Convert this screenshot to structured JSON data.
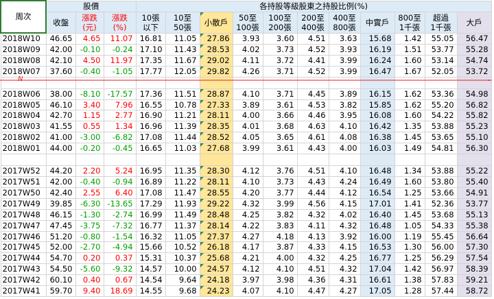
{
  "headers": {
    "week": "周次",
    "price_group": "股價",
    "holding_group": "各持股等級股東之持股比例(%)",
    "close": "收盤",
    "change": "漲跌\n(元)",
    "change_pct": "漲跌\n(%)",
    "b1": "10張\n以下",
    "b2": "10至\n50張",
    "small": "小散戶",
    "b3": "50至\n100張",
    "b4": "100至\n200張",
    "b5": "200至\n400張",
    "b6": "400至\n800張",
    "mid": "中實戶",
    "b7": "800至\n1千張",
    "b8": "超過\n1千張",
    "big": "大戶"
  },
  "marker_label": "N",
  "colors": {
    "up": "#ff0000",
    "down": "#00a000",
    "small_col": "#ffe699",
    "mid_col": "#ddebf7",
    "big_col": "#e4dfec",
    "header": "#ddebf7",
    "marker": "#e02020"
  },
  "groups": [
    {
      "rows": [
        [
          "2018W10",
          "46.65",
          "4.65",
          "11.07",
          "16.81",
          "11.05",
          "27.86",
          "3.93",
          "3.60",
          "4.51",
          "3.63",
          "15.68",
          "1.42",
          "55.05",
          "56.47"
        ],
        [
          "2018W09",
          "42.00",
          "-0.10",
          "-0.24",
          "17.10",
          "11.43",
          "28.53",
          "4.02",
          "3.73",
          "4.52",
          "3.93",
          "16.19",
          "1.51",
          "53.77",
          "55.28"
        ],
        [
          "2018W08",
          "42.10",
          "4.50",
          "11.97",
          "17.35",
          "11.67",
          "29.02",
          "4.11",
          "3.72",
          "4.41",
          "3.99",
          "16.24",
          "1.60",
          "53.14",
          "54.74"
        ],
        [
          "2018W07",
          "37.60",
          "-0.40",
          "-1.05",
          "17.77",
          "12.05",
          "29.82",
          "4.26",
          "3.71",
          "4.52",
          "3.99",
          "16.47",
          "1.67",
          "52.05",
          "53.72"
        ]
      ]
    },
    {
      "rows": [
        [
          "2018W06",
          "38.00",
          "-8.10",
          "-17.57",
          "17.36",
          "11.51",
          "28.87",
          "4.10",
          "3.71",
          "4.45",
          "3.89",
          "16.15",
          "1.62",
          "53.36",
          "54.98"
        ],
        [
          "2018W05",
          "46.10",
          "3.40",
          "7.96",
          "16.55",
          "10.78",
          "27.33",
          "3.89",
          "3.61",
          "4.53",
          "3.82",
          "15.85",
          "1.62",
          "55.20",
          "56.82"
        ],
        [
          "2018W04",
          "42.70",
          "1.15",
          "2.77",
          "16.90",
          "11.21",
          "28.11",
          "4.00",
          "3.66",
          "4.46",
          "3.95",
          "16.08",
          "1.60",
          "54.22",
          "55.82"
        ],
        [
          "2018W03",
          "41.55",
          "0.55",
          "1.34",
          "16.96",
          "11.39",
          "28.35",
          "4.01",
          "3.68",
          "4.63",
          "4.10",
          "16.42",
          "1.35",
          "53.88",
          "55.23"
        ],
        [
          "2018W02",
          "41.00",
          "-3.00",
          "-6.82",
          "17.08",
          "11.44",
          "28.52",
          "4.05",
          "3.65",
          "4.61",
          "4.08",
          "16.38",
          "1.45",
          "53.65",
          "55.10"
        ],
        [
          "2018W01",
          "44.00",
          "-0.20",
          "-0.45",
          "16.65",
          "11.03",
          "27.68",
          "3.99",
          "3.61",
          "4.43",
          "4.00",
          "16.03",
          "1.49",
          "54.81",
          "56.30"
        ]
      ]
    },
    {
      "rows": [
        [
          "2017W52",
          "44.20",
          "2.20",
          "5.24",
          "16.95",
          "11.35",
          "28.30",
          "4.12",
          "3.76",
          "4.51",
          "4.10",
          "16.48",
          "1.34",
          "53.88",
          "55.22"
        ],
        [
          "2017W51",
          "42.00",
          "-0.40",
          "-0.94",
          "16.89",
          "11.22",
          "28.11",
          "4.10",
          "3.73",
          "4.43",
          "4.24",
          "16.49",
          "1.60",
          "53.80",
          "55.40"
        ],
        [
          "2017W50",
          "42.40",
          "2.55",
          "6.40",
          "17.08",
          "11.47",
          "28.55",
          "4.20",
          "3.77",
          "4.44",
          "4.12",
          "16.54",
          "1.25",
          "53.66",
          "54.91"
        ],
        [
          "2017W49",
          "39.85",
          "-6.30",
          "-13.65",
          "17.29",
          "11.93",
          "29.22",
          "4.32",
          "3.99",
          "4.56",
          "4.15",
          "17.01",
          "1.41",
          "52.36",
          "53.77"
        ],
        [
          "2017W48",
          "46.15",
          "-1.30",
          "-2.74",
          "16.99",
          "11.49",
          "28.48",
          "4.25",
          "3.82",
          "4.32",
          "4.02",
          "16.40",
          "1.45",
          "53.68",
          "55.13"
        ],
        [
          "2017W47",
          "47.45",
          "-3.75",
          "-7.32",
          "16.77",
          "11.37",
          "28.14",
          "4.22",
          "3.83",
          "4.11",
          "4.32",
          "16.48",
          "1.05",
          "54.33",
          "55.38"
        ],
        [
          "2017W46",
          "51.20",
          "-0.80",
          "-1.54",
          "16.32",
          "11.05",
          "27.37",
          "4.27",
          "4.18",
          "4.13",
          "3.92",
          "16.00",
          "1.19",
          "55.45",
          "56.64"
        ],
        [
          "2017W45",
          "52.00",
          "-2.70",
          "-4.94",
          "15.66",
          "10.52",
          "26.18",
          "4.17",
          "3.87",
          "4.33",
          "4.15",
          "16.53",
          "1.30",
          "56.00",
          "57.30"
        ],
        [
          "2017W44",
          "54.70",
          "0.20",
          "0.37",
          "15.31",
          "10.37",
          "25.68",
          "4.21",
          "4.00",
          "4.32",
          "4.25",
          "16.77",
          "1.25",
          "56.29",
          "57.54"
        ],
        [
          "2017W43",
          "54.50",
          "-5.60",
          "-9.32",
          "14.57",
          "10.00",
          "24.57",
          "4.12",
          "4.10",
          "4.51",
          "4.32",
          "17.04",
          "1.42",
          "56.97",
          "58.39"
        ],
        [
          "2017W42",
          "60.10",
          "0.40",
          "0.67",
          "14.54",
          "9.64",
          "24.18",
          "3.97",
          "3.98",
          "4.36",
          "4.31",
          "16.61",
          "1.38",
          "57.83",
          "59.21"
        ],
        [
          "2017W41",
          "59.70",
          "9.40",
          "18.69",
          "14.55",
          "9.68",
          "24.23",
          "4.07",
          "4.10",
          "4.47",
          "4.27",
          "17.05",
          "1.28",
          "57.44",
          "58.72"
        ]
      ]
    }
  ]
}
